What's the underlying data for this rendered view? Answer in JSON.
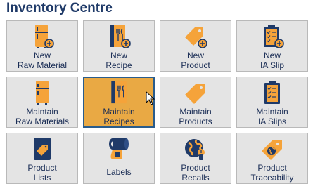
{
  "header": {
    "title": "Inventory Centre"
  },
  "colors": {
    "navy": "#1f3a68",
    "orange": "#f5a33a",
    "tile": "#e4e4e4",
    "selected": "#e9a944"
  },
  "tiles": [
    {
      "line1": "New",
      "line2": "Raw Material",
      "icon": "fridge-add-icon"
    },
    {
      "line1": "New",
      "line2": "Recipe",
      "icon": "recipe-book-add-icon"
    },
    {
      "line1": "New",
      "line2": "Product",
      "icon": "tag-add-icon"
    },
    {
      "line1": "New",
      "line2": "IA Slip",
      "icon": "clipboard-add-icon"
    },
    {
      "line1": "Maintain",
      "line2": "Raw Materials",
      "icon": "fridge-icon"
    },
    {
      "line1": "Maintain",
      "line2": "Recipes",
      "icon": "recipe-book-icon",
      "selected": true
    },
    {
      "line1": "Maintain",
      "line2": "Products",
      "icon": "tag-icon"
    },
    {
      "line1": "Maintain",
      "line2": "IA Slips",
      "icon": "clipboard-icon"
    },
    {
      "line1": "Product",
      "line2": "Lists",
      "icon": "product-list-icon"
    },
    {
      "line1": "Labels",
      "line2": "",
      "icon": "label-roll-icon"
    },
    {
      "line1": "Product",
      "line2": "Recalls",
      "icon": "globe-recall-icon"
    },
    {
      "line1": "Product",
      "line2": "Traceability",
      "icon": "tag-globe-icon"
    }
  ]
}
